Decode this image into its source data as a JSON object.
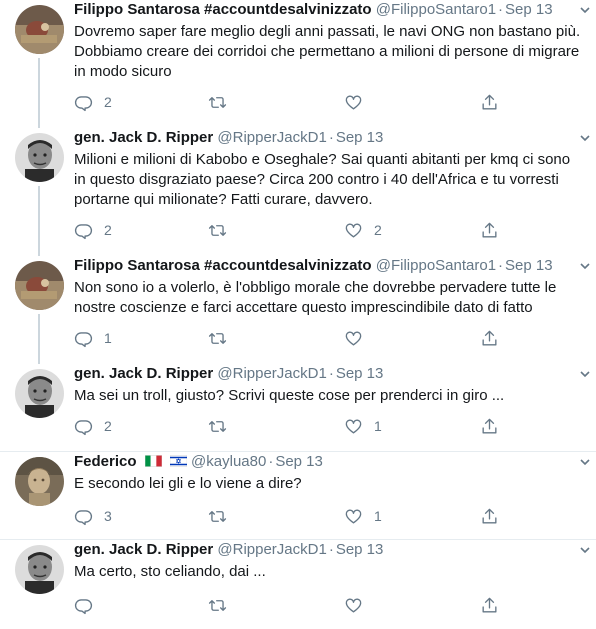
{
  "tweets": [
    {
      "name": "Filippo Santarosa #accountdesalvinizzato",
      "handle": "@FilippoSantaro1",
      "date": "Sep 13",
      "text": "Dovremo saper fare meglio degli anni passati, le navi ONG non bastano più. Dobbiamo creare dei corridoi che permettano a milioni di persone di migrare in modo sicuro",
      "replies": "2",
      "retweets": "",
      "likes": ""
    },
    {
      "name": "gen. Jack D. Ripper",
      "handle": "@RipperJackD1",
      "date": "Sep 13",
      "text": "Milioni e milioni di Kabobo e Oseghale? Sai quanti abitanti per kmq ci sono in questo disgraziato paese? Circa 200 contro i 40 dell'Africa e tu vorresti portarne qui milionate? Fatti curare, davvero.",
      "replies": "2",
      "retweets": "",
      "likes": "2"
    },
    {
      "name": "Filippo Santarosa #accountdesalvinizzato",
      "handle": "@FilippoSantaro1",
      "date": "Sep 13",
      "text": "Non sono io a volerlo, è l'obbligo morale che dovrebbe pervadere tutte le nostre coscienze e farci accettare questo imprescindibile dato di fatto",
      "replies": "1",
      "retweets": "",
      "likes": ""
    },
    {
      "name": "gen. Jack D. Ripper",
      "handle": "@RipperJackD1",
      "date": "Sep 13",
      "text": "Ma sei un troll, giusto? Scrivi queste cose per prenderci in giro ...",
      "replies": "2",
      "retweets": "",
      "likes": "1"
    },
    {
      "name": "Federico",
      "handle": "@kaylua80",
      "date": "Sep 13",
      "text": "E secondo lei gli e lo viene a dire?",
      "replies": "3",
      "retweets": "",
      "likes": "1"
    },
    {
      "name": "gen. Jack D. Ripper",
      "handle": "@RipperJackD1",
      "date": "Sep 13",
      "text": "Ma certo, sto celiando, dai ...",
      "replies": "",
      "retweets": "",
      "likes": ""
    }
  ],
  "flags": [
    "flag-italy-icon",
    "flag-israel-icon"
  ],
  "icons": {
    "reply": "reply-icon",
    "retweet": "retweet-icon",
    "like": "heart-icon",
    "share": "share-icon",
    "more": "chevron-down-icon"
  },
  "colors": {
    "text": "#14171a",
    "secondary": "#657786",
    "thread_line": "#ccd6dd",
    "divider": "#e6ecf0"
  }
}
